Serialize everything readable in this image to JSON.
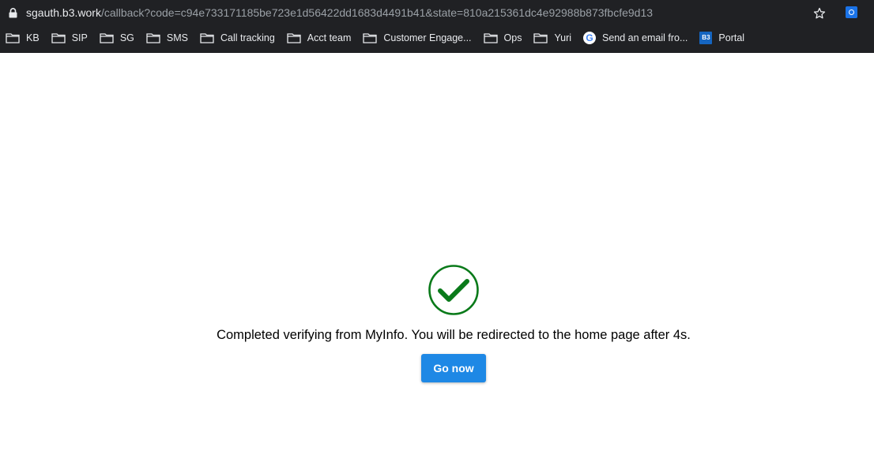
{
  "browser": {
    "url_host": "sgauth.b3.work",
    "url_path": "/callback?code=c94e733171185be723e1d56422dd1683d4491b41&state=810a215361dc4e92988b873fbcfe9d13",
    "bookmarks": [
      {
        "label": "KB",
        "icon": "folder-icon"
      },
      {
        "label": "SIP",
        "icon": "folder-icon"
      },
      {
        "label": "SG",
        "icon": "folder-icon"
      },
      {
        "label": "SMS",
        "icon": "folder-icon"
      },
      {
        "label": "Call tracking",
        "icon": "folder-icon"
      },
      {
        "label": "Acct team",
        "icon": "folder-icon"
      },
      {
        "label": "Customer Engage...",
        "icon": "folder-icon"
      },
      {
        "label": "Ops",
        "icon": "folder-icon"
      },
      {
        "label": "Yuri",
        "icon": "folder-icon"
      },
      {
        "label": "Send an email fro...",
        "icon": "google-icon"
      },
      {
        "label": "Portal",
        "icon": "b3-icon",
        "icon_text": "B3"
      }
    ]
  },
  "page": {
    "message": "Completed verifying from MyInfo. You will be redirected to the home page after 4s.",
    "button_label": "Go now"
  },
  "colors": {
    "check": "#0a7a1a",
    "button": "#1e88e5",
    "chrome": "#202124"
  }
}
